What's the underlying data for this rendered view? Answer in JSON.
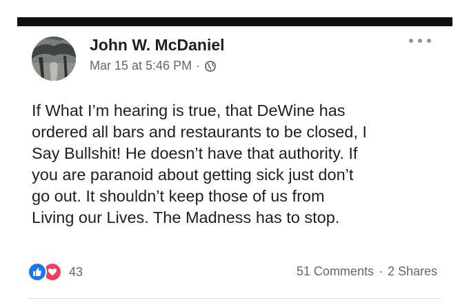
{
  "post": {
    "author": "John W. McDaniel",
    "date": "Mar 15 at 5:46 PM",
    "separator": "·",
    "privacy_icon": "globe-icon",
    "menu_icon": "more-options-icon",
    "body_lines": [
      "If What I’m hearing is true, that DeWine has",
      "ordered all bars and restaurants to be closed, I",
      "Say Bullshit! He doesn’t have that authority. If",
      "you are paranoid about getting sick just don’t",
      "go out. It shouldn’t keep those of us from",
      "Living our Lives. The Madness has to stop."
    ],
    "reactions": {
      "icons": [
        "like-icon",
        "love-icon"
      ],
      "count": "43"
    },
    "comments": "51 Comments",
    "shares": "2 Shares"
  },
  "colors": {
    "like_blue": "#1877f2",
    "love_red": "#f33e58",
    "meta_gray": "#606770",
    "text": "#1c1e21"
  }
}
